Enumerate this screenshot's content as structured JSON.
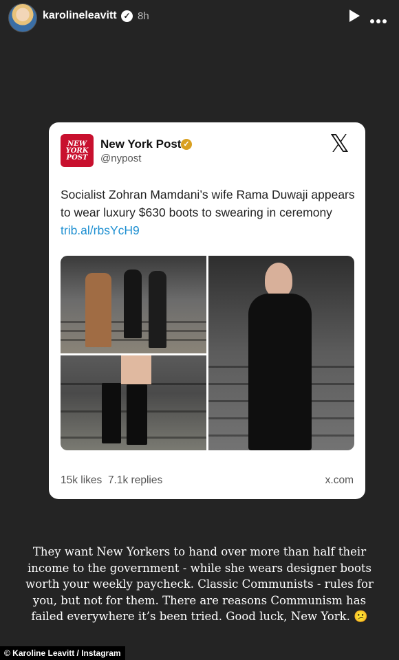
{
  "story_header": {
    "username": "karolineleavitt",
    "verified_glyph": "✓",
    "time_ago": "8h",
    "icons": [
      "avatar",
      "verified-badge-icon",
      "play-icon",
      "more-options-icon"
    ]
  },
  "embedded_post": {
    "account_name": "New York Post",
    "account_verified_glyph": "✓",
    "handle": "@nypost",
    "logo_lines": [
      "NEW",
      "YORK",
      "POST"
    ],
    "platform_icon_glyph": "𝕏",
    "text": "Socialist Zohran Mamdani’s wife Rama Duwaji appears to wear luxury $630 boots to swearing in ceremony",
    "link": "trib.al/rbsYcH9",
    "likes": "15k likes",
    "replies": "7.1k replies",
    "source": "x.com"
  },
  "caption": "They want New Yorkers to hand over more than half their income to the government - while she wears designer boots worth your weekly paycheck. Classic Communists - rules for you, but not for them. There are reasons Communism has failed everywhere it’s been tried. Good luck, New York. 😕",
  "credit": "© Karoline Leavitt / Instagram",
  "colors": {
    "background": "#242424",
    "card": "#ffffff",
    "nypost_red": "#c8102e",
    "link_blue": "#1d8fd1",
    "gold_badge": "#d9a021"
  }
}
